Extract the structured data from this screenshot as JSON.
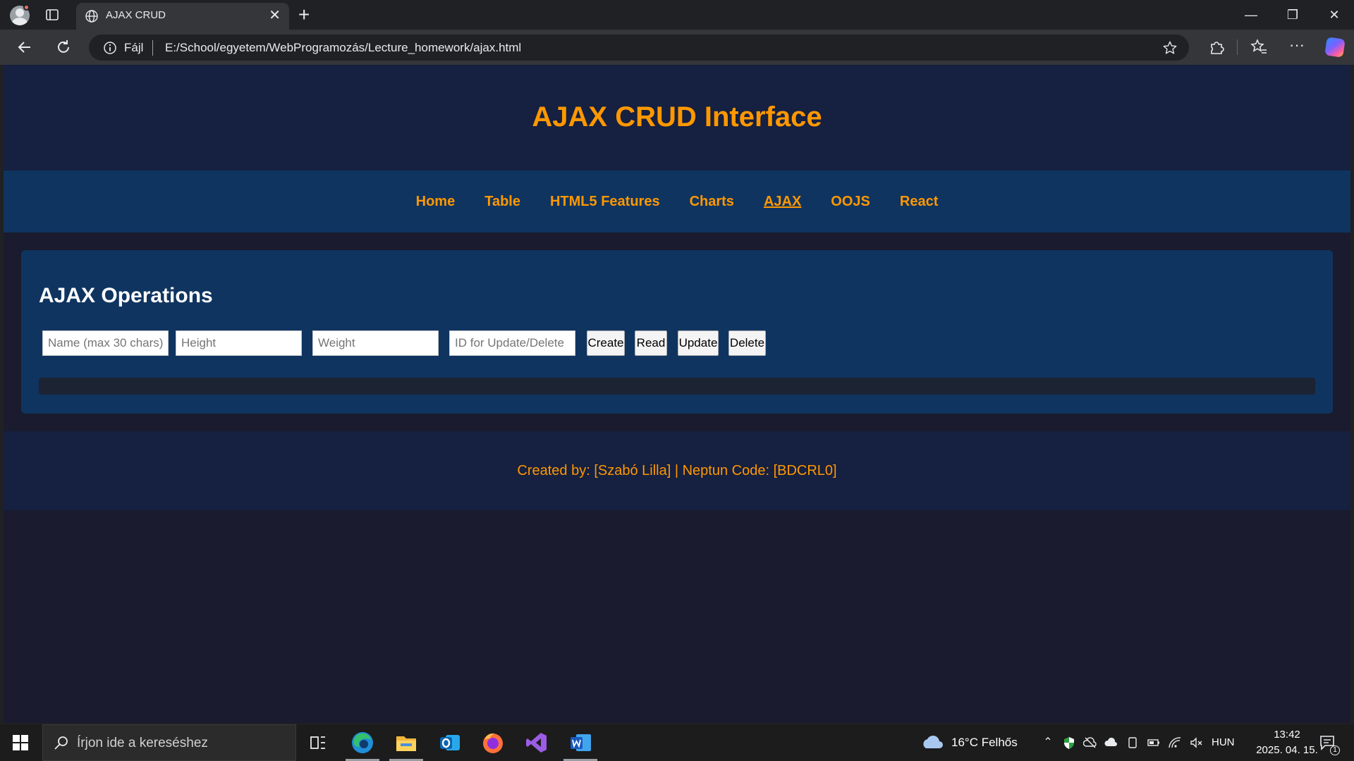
{
  "browser": {
    "tab_title": "AJAX CRUD",
    "address_prefix": "Fájl",
    "url": "E:/School/egyetem/WebProgramozás/Lecture_homework/ajax.html"
  },
  "page": {
    "title": "AJAX CRUD Interface",
    "nav": [
      {
        "label": "Home"
      },
      {
        "label": "Table"
      },
      {
        "label": "HTML5 Features"
      },
      {
        "label": "Charts"
      },
      {
        "label": "AJAX",
        "active": true
      },
      {
        "label": "OOJS"
      },
      {
        "label": "React"
      }
    ],
    "section_title": "AJAX Operations",
    "form": {
      "name_placeholder": "Name (max 30 chars)",
      "height_placeholder": "Height",
      "weight_placeholder": "Weight",
      "id_placeholder": "ID for Update/Delete",
      "create_label": "Create",
      "read_label": "Read",
      "update_label": "Update",
      "delete_label": "Delete"
    },
    "footer": "Created by: [Szabó Lilla] | Neptun Code: [BDCRL0]"
  },
  "taskbar": {
    "search_placeholder": "Írjon ide a kereséshez",
    "weather": "16°C  Felhős",
    "language": "HUN",
    "time": "13:42",
    "date": "2025. 04. 15.",
    "notification_count": "1"
  },
  "colors": {
    "accent": "#ff9800",
    "header_bg": "#162040",
    "nav_bg": "#0f3460",
    "page_bg": "#1a1b2e"
  }
}
